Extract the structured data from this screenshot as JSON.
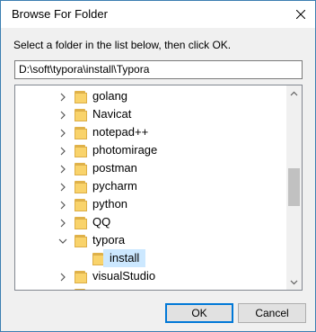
{
  "window": {
    "title": "Browse For Folder",
    "close_icon": "close-icon"
  },
  "instruction": "Select a folder in the list below, then click OK.",
  "path": "D:\\soft\\typora\\install\\Typora",
  "tree": {
    "items": [
      {
        "label": "golang",
        "expanded": false,
        "selected": false
      },
      {
        "label": "Navicat",
        "expanded": false,
        "selected": false
      },
      {
        "label": "notepad++",
        "expanded": false,
        "selected": false
      },
      {
        "label": "photomirage",
        "expanded": false,
        "selected": false
      },
      {
        "label": "postman",
        "expanded": false,
        "selected": false
      },
      {
        "label": "pycharm",
        "expanded": false,
        "selected": false
      },
      {
        "label": "python",
        "expanded": false,
        "selected": false
      },
      {
        "label": "QQ",
        "expanded": false,
        "selected": false
      },
      {
        "label": "typora",
        "expanded": true,
        "selected": false
      },
      {
        "label": "install",
        "expanded": false,
        "selected": true
      },
      {
        "label": "visualStudio",
        "expanded": false,
        "selected": false
      }
    ]
  },
  "buttons": {
    "ok": "OK",
    "cancel": "Cancel"
  },
  "colors": {
    "selection": "#cce8ff",
    "folder": "#f9d36b",
    "accent_border": "#0078d7"
  }
}
